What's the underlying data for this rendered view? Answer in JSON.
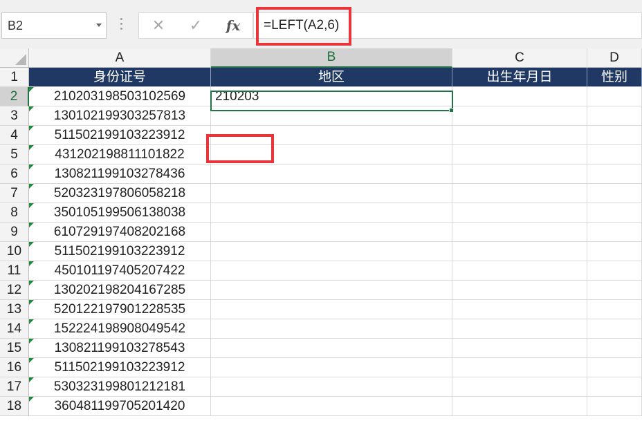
{
  "formula_bar": {
    "name_box": "B2",
    "cancel_icon": "✕",
    "enter_icon": "✓",
    "fx_label": "fx",
    "formula": "=LEFT(A2,6)"
  },
  "columns": [
    "A",
    "B",
    "C",
    "D"
  ],
  "header_row": [
    "身份证号",
    "地区",
    "出生年月日",
    "性别"
  ],
  "rows": [
    {
      "num": "1"
    },
    {
      "num": "2",
      "a": "210203198503102569",
      "b": "210203"
    },
    {
      "num": "3",
      "a": "130102199303257813"
    },
    {
      "num": "4",
      "a": "511502199103223912"
    },
    {
      "num": "5",
      "a": "431202198811101822"
    },
    {
      "num": "6",
      "a": "130821199103278436"
    },
    {
      "num": "7",
      "a": "520323197806058218"
    },
    {
      "num": "8",
      "a": "350105199506138038"
    },
    {
      "num": "9",
      "a": "610729197408202168"
    },
    {
      "num": "10",
      "a": "511502199103223912"
    },
    {
      "num": "11",
      "a": "450101197405207422"
    },
    {
      "num": "12",
      "a": "130202198204167285"
    },
    {
      "num": "13",
      "a": "520122197901228535"
    },
    {
      "num": "14",
      "a": "152224198908049542"
    },
    {
      "num": "15",
      "a": "130821199103278543"
    },
    {
      "num": "16",
      "a": "511502199103223912"
    },
    {
      "num": "17",
      "a": "530323199801212181"
    },
    {
      "num": "18",
      "a": "360481199705201420"
    }
  ],
  "selection": {
    "active_cell": "B2"
  }
}
